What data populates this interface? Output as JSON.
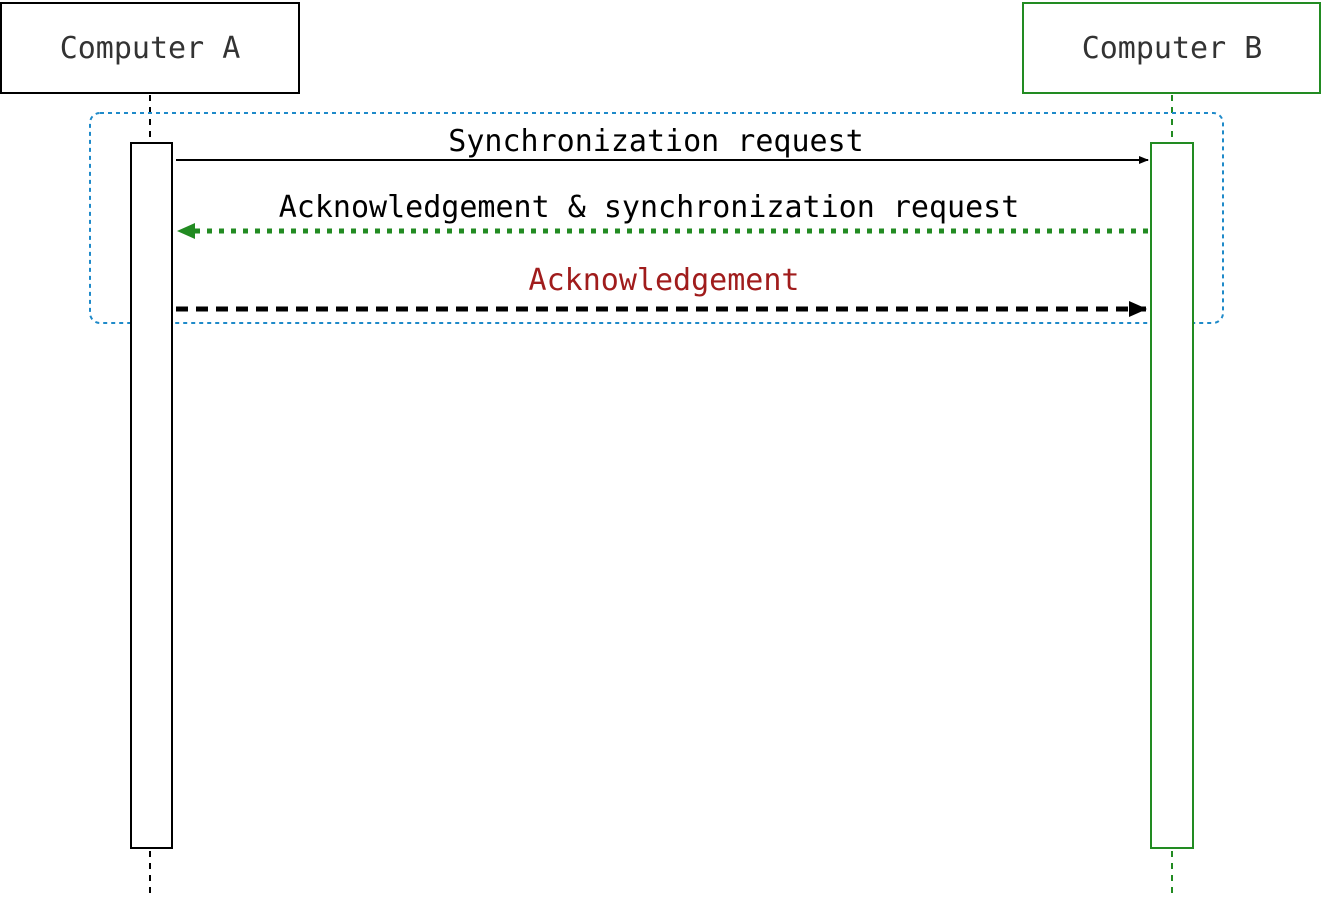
{
  "participants": {
    "a": {
      "label": "Computer A",
      "color": "#000000",
      "text_color": "#333333"
    },
    "b": {
      "label": "Computer B",
      "color": "#228b22",
      "text_color": "#333333"
    }
  },
  "messages": [
    {
      "label": "Synchronization request",
      "from": "a",
      "to": "b",
      "style": "solid",
      "color": "#000000",
      "label_color": "#000000"
    },
    {
      "label": "Acknowledgement & synchronization request",
      "from": "b",
      "to": "a",
      "style": "dotted",
      "color": "#228b22",
      "label_color": "#000000"
    },
    {
      "label": "Acknowledgement",
      "from": "a",
      "to": "b",
      "style": "dashed",
      "color": "#000000",
      "label_color": "#a01c1c"
    }
  ],
  "group": {
    "color": "#1f8ac9"
  }
}
